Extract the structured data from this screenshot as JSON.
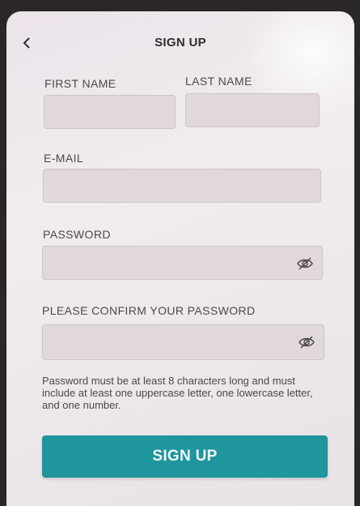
{
  "header": {
    "title": "SIGN UP",
    "back_icon": "chevron-left-icon"
  },
  "form": {
    "first_name_label": "FIRST NAME",
    "first_name_value": "",
    "last_name_label": "LAST NAME",
    "last_name_value": "",
    "email_label": "E-MAIL",
    "email_value": "",
    "password_label": "PASSWORD",
    "password_value": "",
    "confirm_password_label": "PLEASE CONFIRM YOUR PASSWORD",
    "confirm_password_value": "",
    "toggle_icon": "eye-slash-icon"
  },
  "hint": "Password must be at least 8 characters long and must include at least one uppercase letter, one lowercase letter, and one number.",
  "submit_label": "SIGN UP",
  "colors": {
    "accent": "#1f959d",
    "field_bg": "#e0d8dd",
    "text": "#3c3a3c"
  }
}
